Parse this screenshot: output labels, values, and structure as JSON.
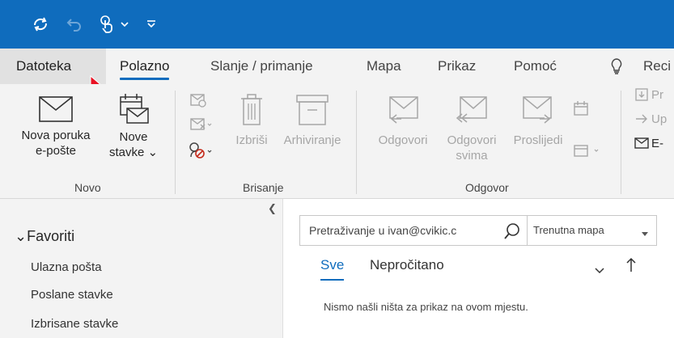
{
  "quick_access": {
    "icons": [
      "sync-icon",
      "undo-icon",
      "touch-mode-icon",
      "chevron-down-icon",
      "customize-qat-icon"
    ]
  },
  "tabs": {
    "file": "Datoteka",
    "home": "Polazno",
    "send_receive": "Slanje / primanje",
    "folder": "Mapa",
    "view": "Prikaz",
    "help": "Pomoć",
    "tell_me": "Reci"
  },
  "ribbon": {
    "new": {
      "group_label": "Novo",
      "new_email_line1": "Nova poruka",
      "new_email_line2": "e-pošte",
      "new_items_line1": "Nove",
      "new_items_line2": "stavke"
    },
    "delete": {
      "group_label": "Brisanje",
      "delete_label": "Izbriši",
      "archive_label": "Arhiviranje"
    },
    "respond": {
      "group_label": "Odgovor",
      "reply_label": "Odgovori",
      "reply_all_line1": "Odgovori",
      "reply_all_line2": "svima",
      "forward_label": "Proslijedi"
    },
    "quick_steps": {
      "item1": "Pr",
      "item2": "Up",
      "item3": "E-"
    }
  },
  "nav": {
    "favorites_label": "Favoriti",
    "folders": [
      "Ulazna pošta",
      "Poslane stavke",
      "Izbrisane stavke"
    ]
  },
  "mail_list": {
    "search_placeholder": "Pretraživanje u ivan@cvikic.c",
    "scope_label": "Trenutna mapa",
    "filter_all": "Sve",
    "filter_unread": "Nepročitano",
    "empty_message": "Nismo našli ništa za prikaz na ovom mjestu."
  },
  "colors": {
    "accent": "#0f6cbd",
    "ribbon_bg": "#f3f3f3",
    "disabled": "#a6a6a6"
  }
}
